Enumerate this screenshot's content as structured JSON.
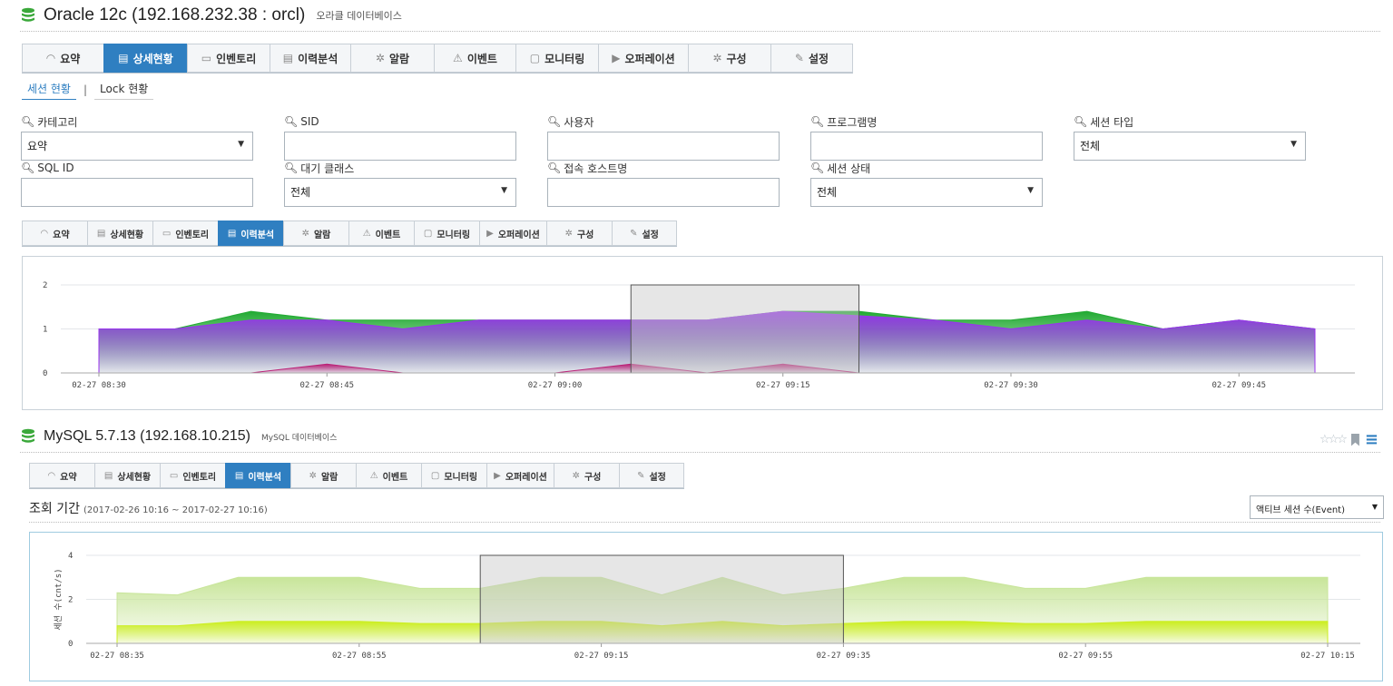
{
  "header": {
    "title": "Oracle 12c (192.168.232.38 : orcl)",
    "subtitle": "오라클 데이터베이스"
  },
  "main_tabs": [
    {
      "icon": "gauge-icon",
      "label": "요약",
      "active": false
    },
    {
      "icon": "list-icon",
      "label": "상세현황",
      "active": true
    },
    {
      "icon": "hdd-icon",
      "label": "인벤토리",
      "active": false
    },
    {
      "icon": "list-icon",
      "label": "이력분석",
      "active": false
    },
    {
      "icon": "alarm-icon",
      "label": "알람",
      "active": false
    },
    {
      "icon": "warning-icon",
      "label": "이벤트",
      "active": false
    },
    {
      "icon": "monitor-icon",
      "label": "모니터링",
      "active": false
    },
    {
      "icon": "play-icon",
      "label": "오퍼레이션",
      "active": false
    },
    {
      "icon": "gear-icon",
      "label": "구성",
      "active": false
    },
    {
      "icon": "wrench-icon",
      "label": "설정",
      "active": false
    }
  ],
  "sub_tabs": [
    {
      "label": "세션 현황",
      "active": true
    },
    {
      "label": "Lock 현황",
      "active": false
    }
  ],
  "filters": {
    "category": {
      "label": "카테고리",
      "value": "요약"
    },
    "sid": {
      "label": "SID",
      "value": ""
    },
    "user": {
      "label": "사용자",
      "value": ""
    },
    "program": {
      "label": "프로그램명",
      "value": ""
    },
    "session_type": {
      "label": "세션 타입",
      "value": "전체"
    },
    "sql_id": {
      "label": "SQL ID",
      "value": ""
    },
    "wait_class": {
      "label": "대기 클래스",
      "value": "전체"
    },
    "host": {
      "label": "접속 호스트명",
      "value": ""
    },
    "session_state": {
      "label": "세션 상태",
      "value": "전체"
    }
  },
  "oracle_tabs": [
    {
      "icon": "gauge-icon",
      "label": "요약",
      "active": false
    },
    {
      "icon": "list-icon",
      "label": "상세현황",
      "active": false
    },
    {
      "icon": "hdd-icon",
      "label": "인벤토리",
      "active": false
    },
    {
      "icon": "list-icon",
      "label": "이력분석",
      "active": true
    },
    {
      "icon": "alarm-icon",
      "label": "알람",
      "active": false
    },
    {
      "icon": "warning-icon",
      "label": "이벤트",
      "active": false
    },
    {
      "icon": "monitor-icon",
      "label": "모니터링",
      "active": false
    },
    {
      "icon": "play-icon",
      "label": "오퍼레이션",
      "active": false
    },
    {
      "icon": "gear-icon",
      "label": "구성",
      "active": false
    },
    {
      "icon": "wrench-icon",
      "label": "설정",
      "active": false
    }
  ],
  "mysql": {
    "title": "MySQL 5.7.13 (192.168.10.215)",
    "subtitle": "MySQL 데이터베이스",
    "tabs": [
      {
        "icon": "gauge-icon",
        "label": "요약",
        "active": false
      },
      {
        "icon": "list-icon",
        "label": "상세현황",
        "active": false
      },
      {
        "icon": "hdd-icon",
        "label": "인벤토리",
        "active": false
      },
      {
        "icon": "list-icon",
        "label": "이력분석",
        "active": true
      },
      {
        "icon": "alarm-icon",
        "label": "알람",
        "active": false
      },
      {
        "icon": "warning-icon",
        "label": "이벤트",
        "active": false
      },
      {
        "icon": "monitor-icon",
        "label": "모니터링",
        "active": false
      },
      {
        "icon": "play-icon",
        "label": "오퍼레이션",
        "active": false
      },
      {
        "icon": "gear-icon",
        "label": "구성",
        "active": false
      },
      {
        "icon": "wrench-icon",
        "label": "설정",
        "active": false
      }
    ],
    "period_label": "조회 기간",
    "period_value": "(2017-02-26 10:16 ~ 2017-02-27 10:16)",
    "metric_select": "액티브 세션 수(Event)",
    "icons": [
      "star-icon",
      "bookmark-icon",
      "menu-icon"
    ]
  },
  "colors": {
    "accent": "#2f7fc1",
    "green": "#22aa33",
    "purple": "#9933ee",
    "lime": "#ccee22"
  },
  "chart_data": [
    {
      "type": "area",
      "title": "",
      "x": [
        "02-27 08:30",
        "02-27 08:35",
        "02-27 08:40",
        "02-27 08:45",
        "02-27 08:50",
        "02-27 08:55",
        "02-27 09:00",
        "02-27 09:05",
        "02-27 09:10",
        "02-27 09:15",
        "02-27 09:20",
        "02-27 09:25",
        "02-27 09:30",
        "02-27 09:35",
        "02-27 09:40",
        "02-27 09:45",
        "02-27 09:50"
      ],
      "x_ticks": [
        "02-27 08:30",
        "02-27 08:45",
        "02-27 09:00",
        "02-27 09:15",
        "02-27 09:30",
        "02-27 09:45"
      ],
      "series": [
        {
          "color": "#22aa33",
          "values": [
            1.0,
            1.0,
            1.4,
            1.2,
            1.2,
            1.2,
            1.2,
            1.2,
            1.2,
            1.4,
            1.4,
            1.2,
            1.2,
            1.4,
            1.0,
            1.2,
            1.0
          ]
        },
        {
          "color": "#9933ee",
          "values": [
            1.0,
            1.0,
            1.2,
            1.2,
            1.0,
            1.2,
            1.2,
            1.2,
            1.2,
            1.4,
            1.3,
            1.2,
            1.0,
            1.2,
            1.0,
            1.2,
            1.0
          ]
        },
        {
          "color": "#bb2277",
          "values": [
            0,
            0,
            0,
            0.2,
            0,
            0,
            0,
            0.2,
            0,
            0.2,
            0,
            0,
            0,
            0,
            0,
            0,
            0
          ]
        }
      ],
      "ylim": [
        0,
        2
      ],
      "y_ticks": [
        0,
        1,
        2
      ],
      "xlabel": "",
      "ylabel": "",
      "selection": [
        "02-27 09:05",
        "02-27 09:20"
      ],
      "grid": true
    },
    {
      "type": "area",
      "title": "",
      "x": [
        "02-27 08:35",
        "02-27 08:40",
        "02-27 08:45",
        "02-27 08:50",
        "02-27 08:55",
        "02-27 09:00",
        "02-27 09:05",
        "02-27 09:10",
        "02-27 09:15",
        "02-27 09:20",
        "02-27 09:25",
        "02-27 09:30",
        "02-27 09:35",
        "02-27 09:40",
        "02-27 09:45",
        "02-27 09:50",
        "02-27 09:55",
        "02-27 10:00",
        "02-27 10:05",
        "02-27 10:10",
        "02-27 10:15"
      ],
      "x_ticks": [
        "02-27 08:35",
        "02-27 08:55",
        "02-27 09:15",
        "02-27 09:35",
        "02-27 09:55",
        "02-27 10:15"
      ],
      "series": [
        {
          "color": "#c8e59a",
          "values": [
            2.3,
            2.2,
            3.0,
            3.0,
            3.0,
            2.5,
            2.5,
            3.0,
            3.0,
            2.2,
            3.0,
            2.2,
            2.5,
            3.0,
            3.0,
            2.5,
            2.5,
            3.0,
            3.0,
            3.0,
            3.0
          ]
        },
        {
          "color": "#ccee22",
          "values": [
            0.8,
            0.8,
            1.0,
            1.0,
            1.0,
            0.9,
            0.9,
            1.0,
            1.0,
            0.8,
            1.0,
            0.8,
            0.9,
            1.0,
            1.0,
            0.9,
            0.9,
            1.0,
            1.0,
            1.0,
            1.0
          ]
        }
      ],
      "ylim": [
        0,
        4
      ],
      "y_ticks": [
        0,
        2,
        4
      ],
      "xlabel": "",
      "ylabel": "세션 수(cnt/s)",
      "selection": [
        "02-27 09:05",
        "02-27 09:35"
      ],
      "grid": true
    }
  ]
}
